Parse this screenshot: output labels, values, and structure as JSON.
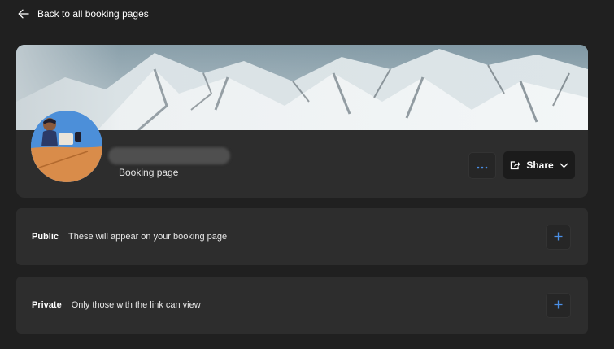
{
  "nav": {
    "back_label": "Back to all booking pages"
  },
  "profile": {
    "subtitle": "Booking page"
  },
  "actions": {
    "more_icon": "more-horizontal-icon",
    "share_label": "Share",
    "share_icon": "share-icon"
  },
  "sections": [
    {
      "title": "Public",
      "description": "These will appear on your booking page",
      "add_icon": "plus-icon"
    },
    {
      "title": "Private",
      "description": "Only those with the link can view",
      "add_icon": "plus-icon"
    }
  ],
  "colors": {
    "background": "#202020",
    "card": "#2d2d2d",
    "accent": "#4a8fe7"
  }
}
